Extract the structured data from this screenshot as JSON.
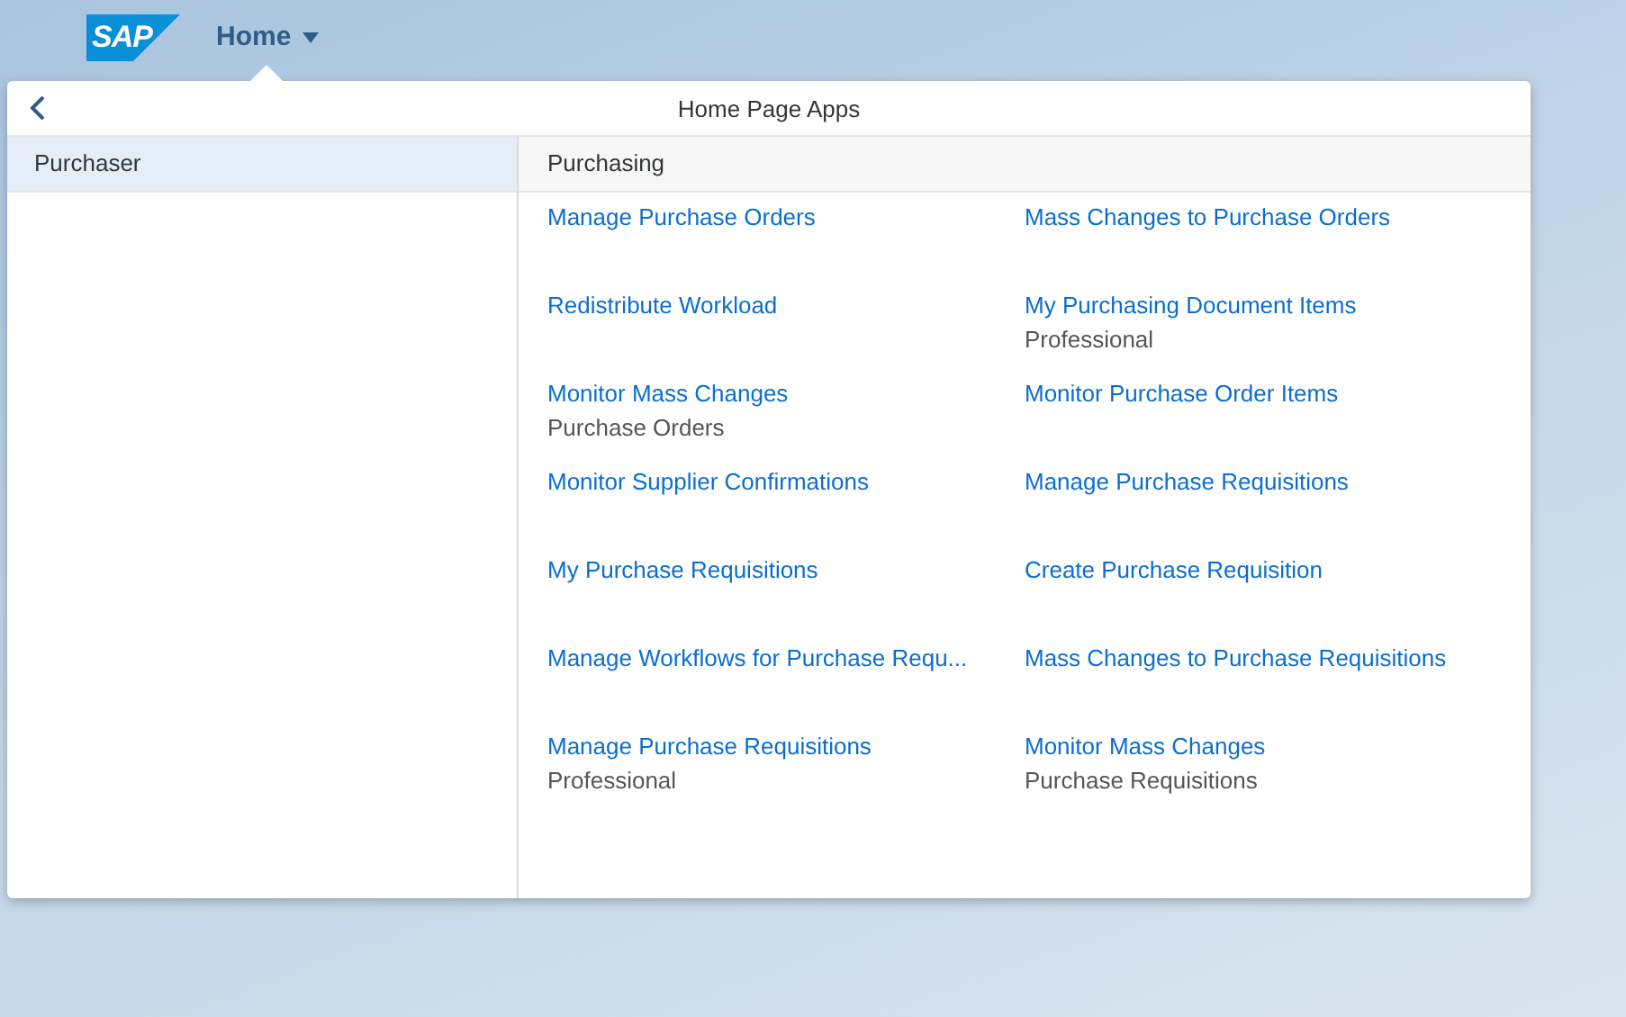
{
  "shell": {
    "logo": "SAP",
    "title": "Home"
  },
  "popover": {
    "title": "Home Page Apps",
    "roles": [
      {
        "label": "Purchaser",
        "selected": true
      }
    ],
    "group": {
      "title": "Purchasing",
      "apps": [
        {
          "title": "Manage Purchase Orders"
        },
        {
          "title": "Mass Changes to Purchase Orders"
        },
        {
          "title": "Redistribute Workload"
        },
        {
          "title": "My Purchasing Document Items",
          "subtitle": "Professional"
        },
        {
          "title": "Monitor Mass Changes",
          "subtitle": "Purchase Orders"
        },
        {
          "title": "Monitor Purchase Order Items"
        },
        {
          "title": "Monitor Supplier Confirmations"
        },
        {
          "title": "Manage Purchase Requisitions"
        },
        {
          "title": "My Purchase Requisitions"
        },
        {
          "title": "Create Purchase Requisition"
        },
        {
          "title": "Manage Workflows for Purchase Requ..."
        },
        {
          "title": "Mass Changes to Purchase Requisitions"
        },
        {
          "title": "Manage Purchase Requisitions",
          "subtitle": "Professional"
        },
        {
          "title": "Monitor Mass Changes",
          "subtitle": "Purchase Requisitions"
        }
      ]
    }
  }
}
